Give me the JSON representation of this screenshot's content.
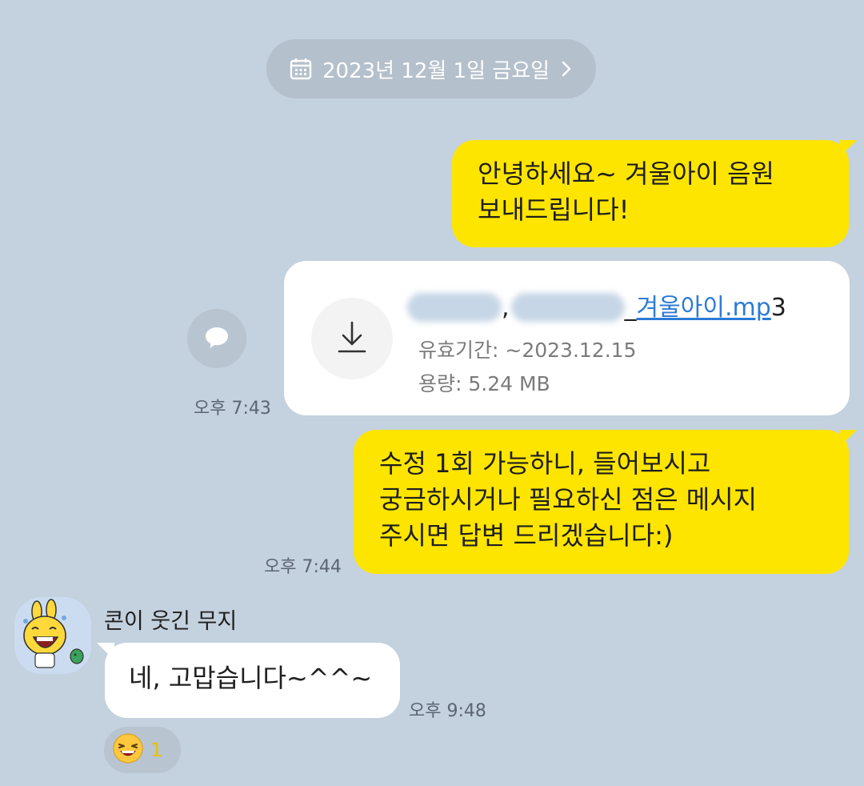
{
  "date_divider": {
    "icon": "calendar-icon",
    "label": "2023년 12월 1일 금요일",
    "chevron": "chevron-right-icon"
  },
  "messages": {
    "m1": {
      "sender": "me",
      "lines": [
        "안녕하세요~ 겨울아이 음원",
        "보내드립니다!"
      ]
    },
    "file": {
      "sender": "me",
      "icon": "download-icon",
      "name_sep": ",",
      "name_sep2": "_",
      "name_link": "겨울아이.mp",
      "name_tail": "3",
      "expiry": "유효기간: ~2023.12.15",
      "size": "용량: 5.24 MB",
      "time": "오후 7:43"
    },
    "m2": {
      "sender": "me",
      "lines": [
        "수정 1회 가능하니, 들어보시고",
        "궁금하시거나 필요하신 점은 메시지",
        "주시면 답변 드리겠습니다:)"
      ],
      "time": "오후 7:44"
    },
    "m3": {
      "sender": "콘이 웃긴 무지",
      "text": "네, 고맙습니다~^^~",
      "time": "오후 9:48",
      "reaction": {
        "icon": "laughing-emoji-icon",
        "count": "1"
      }
    }
  },
  "share_button": {
    "icon": "chat-bubble-icon"
  },
  "colors": {
    "background": "#c4d1de",
    "my_bubble": "#fee500",
    "their_bubble": "#ffffff",
    "link": "#2c7bd6"
  }
}
